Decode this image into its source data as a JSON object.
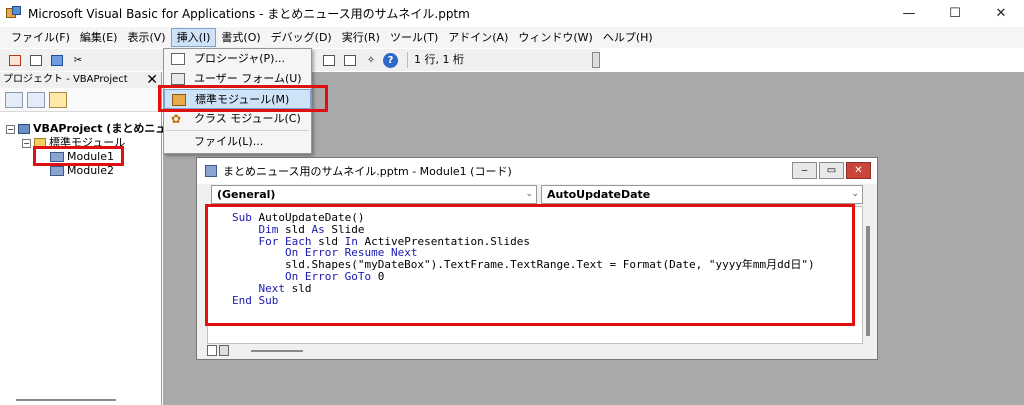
{
  "window": {
    "title": "Microsoft Visual Basic for Applications - まとめニュース用のサムネイル.pptm",
    "minimize": "—",
    "maximize": "☐",
    "close": "✕"
  },
  "menu": [
    {
      "label": "ファイル(F)",
      "name": "menu-file"
    },
    {
      "label": "編集(E)",
      "name": "menu-edit"
    },
    {
      "label": "表示(V)",
      "name": "menu-view"
    },
    {
      "label": "挿入(I)",
      "name": "menu-insert"
    },
    {
      "label": "書式(O)",
      "name": "menu-format"
    },
    {
      "label": "デバッグ(D)",
      "name": "menu-debug"
    },
    {
      "label": "実行(R)",
      "name": "menu-run"
    },
    {
      "label": "ツール(T)",
      "name": "menu-tools"
    },
    {
      "label": "アドイン(A)",
      "name": "menu-addins"
    },
    {
      "label": "ウィンドウ(W)",
      "name": "menu-window"
    },
    {
      "label": "ヘルプ(H)",
      "name": "menu-help"
    }
  ],
  "toolbar": {
    "position": "1 行, 1 桁",
    "help": "?"
  },
  "insert_menu": {
    "procedure": "プロシージャ(P)...",
    "userform": "ユーザー フォーム(U)",
    "std_module": "標準モジュール(M)",
    "class_module": "クラス モジュール(C)",
    "file": "ファイル(L)..."
  },
  "project": {
    "title": "プロジェクト - VBAProject",
    "close": "✕",
    "root": "VBAProject (まとめニュー",
    "folder": "標準モジュール",
    "modules": [
      "Module1",
      "Module2"
    ]
  },
  "code_window": {
    "title": "まとめニュース用のサムネイル.pptm - Module1 (コード)",
    "object_combo": "(General)",
    "proc_combo": "AutoUpdateDate",
    "code_lines": [
      "Sub AutoUpdateDate()",
      "    Dim sld As Slide",
      "    For Each sld In ActivePresentation.Slides",
      "        On Error Resume Next",
      "        sld.Shapes(\"myDateBox\").TextFrame.TextRange.Text = Format(Date, \"yyyy年mm月dd日\")",
      "        On Error GoTo 0",
      "    Next sld",
      "End Sub"
    ]
  },
  "colors": {
    "highlight": "#e01010",
    "keyword": "#1a1ab0"
  }
}
